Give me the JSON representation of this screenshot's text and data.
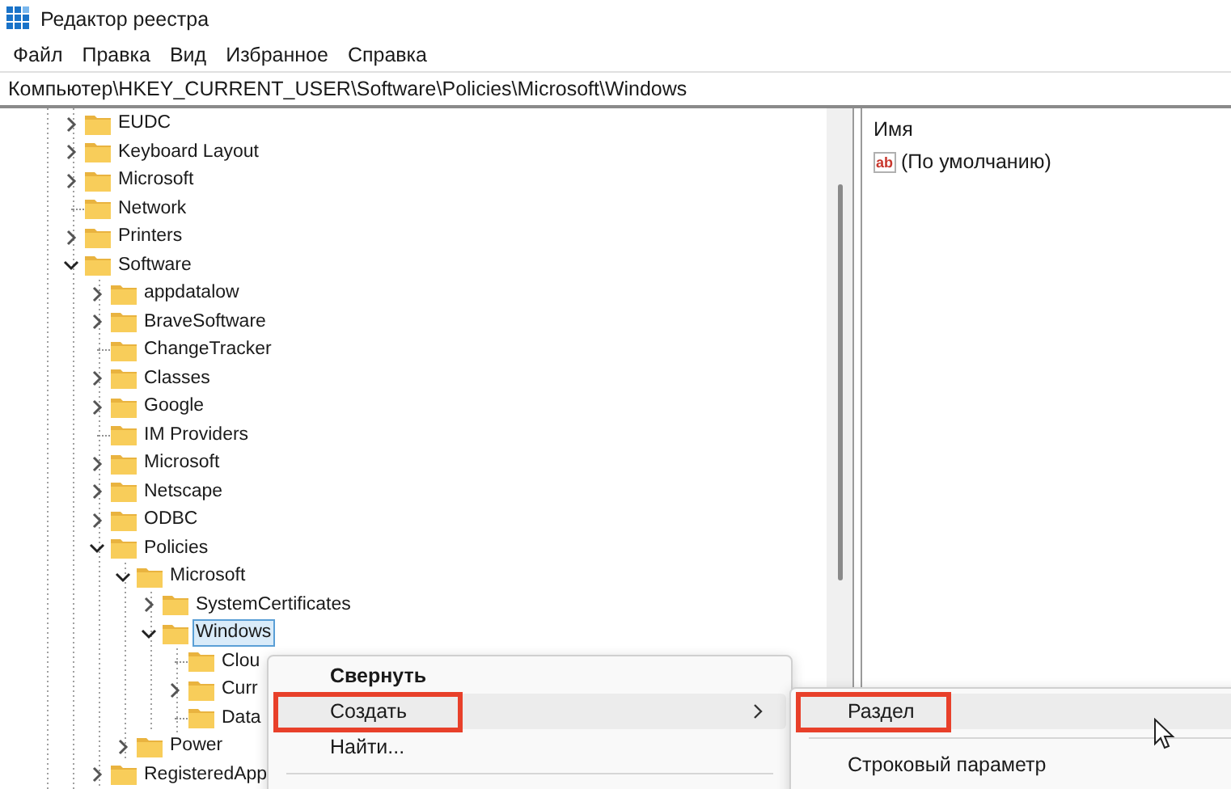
{
  "window": {
    "title": "Редактор реестра"
  },
  "menu_bar": [
    "Файл",
    "Правка",
    "Вид",
    "Избранное",
    "Справка"
  ],
  "address_bar": {
    "value": "Компьютер\\HKEY_CURRENT_USER\\Software\\Policies\\Microsoft\\Windows"
  },
  "tree": [
    {
      "label": "EUDC",
      "expandable": true,
      "expanded": false,
      "selected": false
    },
    {
      "label": "Keyboard Layout",
      "expandable": true,
      "expanded": false,
      "selected": false
    },
    {
      "label": "Microsoft",
      "expandable": true,
      "expanded": false,
      "selected": false
    },
    {
      "label": "Network",
      "expandable": false,
      "selected": false
    },
    {
      "label": "Printers",
      "expandable": true,
      "expanded": false,
      "selected": false
    },
    {
      "label": "Software",
      "expandable": true,
      "expanded": true,
      "selected": false,
      "children": [
        {
          "label": "appdatalow",
          "expandable": true,
          "expanded": false,
          "selected": false
        },
        {
          "label": "BraveSoftware",
          "expandable": true,
          "expanded": false,
          "selected": false
        },
        {
          "label": "ChangeTracker",
          "expandable": false,
          "selected": false
        },
        {
          "label": "Classes",
          "expandable": true,
          "expanded": false,
          "selected": false
        },
        {
          "label": "Google",
          "expandable": true,
          "expanded": false,
          "selected": false
        },
        {
          "label": "IM Providers",
          "expandable": false,
          "selected": false
        },
        {
          "label": "Microsoft",
          "expandable": true,
          "expanded": false,
          "selected": false
        },
        {
          "label": "Netscape",
          "expandable": true,
          "expanded": false,
          "selected": false
        },
        {
          "label": "ODBC",
          "expandable": true,
          "expanded": false,
          "selected": false
        },
        {
          "label": "Policies",
          "expandable": true,
          "expanded": true,
          "selected": false,
          "children": [
            {
              "label": "Microsoft",
              "expandable": true,
              "expanded": true,
              "selected": false,
              "children": [
                {
                  "label": "SystemCertificates",
                  "expandable": true,
                  "expanded": false,
                  "selected": false
                },
                {
                  "label": "Windows",
                  "expandable": true,
                  "expanded": true,
                  "selected": true,
                  "children": [
                    {
                      "label": "Clou",
                      "expandable": false,
                      "selected": false
                    },
                    {
                      "label": "Curr",
                      "expandable": true,
                      "expanded": false,
                      "selected": false
                    },
                    {
                      "label": "Data",
                      "expandable": false,
                      "selected": false
                    }
                  ]
                }
              ]
            },
            {
              "label": "Power",
              "expandable": true,
              "expanded": false,
              "selected": false
            }
          ]
        },
        {
          "label": "RegisteredApp",
          "expandable": true,
          "expanded": false,
          "selected": false
        }
      ]
    }
  ],
  "values_list": {
    "columns": [
      "Имя"
    ],
    "rows": [
      {
        "type_badge": "ab",
        "name": "(По умолчанию)"
      }
    ]
  },
  "context_menu": {
    "items": [
      {
        "kind": "item",
        "label": "Свернуть",
        "default": true,
        "highlighted": false,
        "has_submenu": false,
        "annotated": false
      },
      {
        "kind": "item",
        "label": "Создать",
        "default": false,
        "highlighted": true,
        "has_submenu": true,
        "annotated": true
      },
      {
        "kind": "item",
        "label": "Найти...",
        "default": false,
        "highlighted": false,
        "has_submenu": false,
        "annotated": false
      },
      {
        "kind": "separator"
      }
    ]
  },
  "submenu": {
    "items": [
      {
        "kind": "item",
        "label": "Раздел",
        "default": false,
        "highlighted": true,
        "has_submenu": false,
        "annotated": true
      },
      {
        "kind": "separator"
      },
      {
        "kind": "item",
        "label": "Строковый параметр",
        "default": false,
        "highlighted": false,
        "has_submenu": false,
        "annotated": false
      }
    ]
  }
}
